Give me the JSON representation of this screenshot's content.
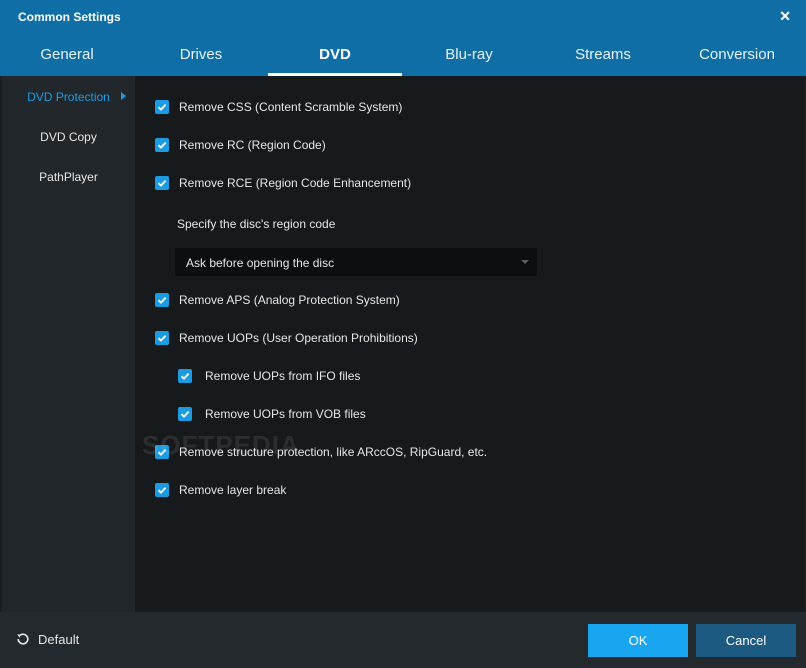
{
  "window": {
    "title": "Common Settings",
    "close_glyph": "✕"
  },
  "tabs": [
    {
      "label": "General",
      "active": false
    },
    {
      "label": "Drives",
      "active": false
    },
    {
      "label": "DVD",
      "active": true
    },
    {
      "label": "Blu-ray",
      "active": false
    },
    {
      "label": "Streams",
      "active": false
    },
    {
      "label": "Conversion",
      "active": false
    }
  ],
  "sidebar": {
    "items": [
      {
        "label": "DVD Protection",
        "active": true
      },
      {
        "label": "DVD Copy",
        "active": false
      },
      {
        "label": "PathPlayer",
        "active": false
      }
    ]
  },
  "options": {
    "remove_css": {
      "label": "Remove CSS (Content Scramble System)",
      "checked": true
    },
    "remove_rc": {
      "label": "Remove RC (Region Code)",
      "checked": true
    },
    "remove_rce": {
      "label": "Remove RCE (Region Code Enhancement)",
      "checked": true
    },
    "region_label": "Specify the disc's region code",
    "region_select": {
      "value": "Ask before opening the disc"
    },
    "remove_aps": {
      "label": "Remove APS (Analog Protection System)",
      "checked": true
    },
    "remove_uops": {
      "label": "Remove UOPs (User Operation Prohibitions)",
      "checked": true
    },
    "remove_uops_ifo": {
      "label": "Remove UOPs from IFO files",
      "checked": true
    },
    "remove_uops_vob": {
      "label": "Remove UOPs from VOB files",
      "checked": true
    },
    "remove_structure": {
      "label": "Remove structure protection, like ARccOS, RipGuard, etc.",
      "checked": true
    },
    "remove_layer_break": {
      "label": "Remove layer break",
      "checked": true
    }
  },
  "watermark": "SOFTPEDIA",
  "footer": {
    "default_label": "Default",
    "ok_label": "OK",
    "cancel_label": "Cancel"
  },
  "colors": {
    "accent": "#1a9be2",
    "header": "#0f6ea6",
    "ok_button": "#17a6ef",
    "cancel_button": "#1c5a82"
  }
}
